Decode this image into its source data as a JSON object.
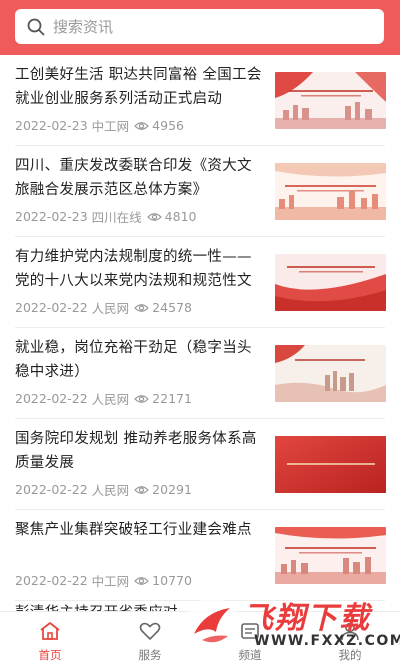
{
  "search": {
    "placeholder": "搜索资讯",
    "icon": "search-icon"
  },
  "colors": {
    "accent": "#ef5a5a",
    "active_tab": "#e8473f",
    "meta": "#999999"
  },
  "news": [
    {
      "title": "工创美好生活 职达共同富裕 全国工会就业创业服务系列活动正式启动",
      "date": "2022-02-23",
      "source": "中工网",
      "views": "4956"
    },
    {
      "title": "四川、重庆发改委联合印发《资大文旅融合发展示范区总体方案》",
      "date": "2022-02-23",
      "source": "四川在线",
      "views": "4810"
    },
    {
      "title": "有力维护党内法规制度的统一性——党的十八大以来党内法规和规范性文件…",
      "date": "2022-02-22",
      "source": "人民网",
      "views": "24578"
    },
    {
      "title": "就业稳，岗位充裕干劲足（稳字当头 稳中求进）",
      "date": "2022-02-22",
      "source": "人民网",
      "views": "22171"
    },
    {
      "title": "国务院印发规划 推动养老服务体系高质量发展",
      "date": "2022-02-22",
      "source": "人民网",
      "views": "20291"
    },
    {
      "title": "聚焦产业集群突破轻工行业建会难点",
      "date": "2022-02-22",
      "source": "中工网",
      "views": "10770"
    },
    {
      "title": "彭清华主持召开省委应对",
      "date": "",
      "source": "",
      "views": ""
    }
  ],
  "tabs": [
    {
      "label": "首页",
      "icon": "home-icon",
      "active": true
    },
    {
      "label": "服务",
      "icon": "heart-icon",
      "active": false
    },
    {
      "label": "频道",
      "icon": "channel-icon",
      "active": false
    },
    {
      "label": "我的",
      "icon": "user-icon",
      "active": false
    }
  ],
  "watermark": {
    "text": "飞翔下载",
    "url": "WWW.FXXZ.COM"
  }
}
